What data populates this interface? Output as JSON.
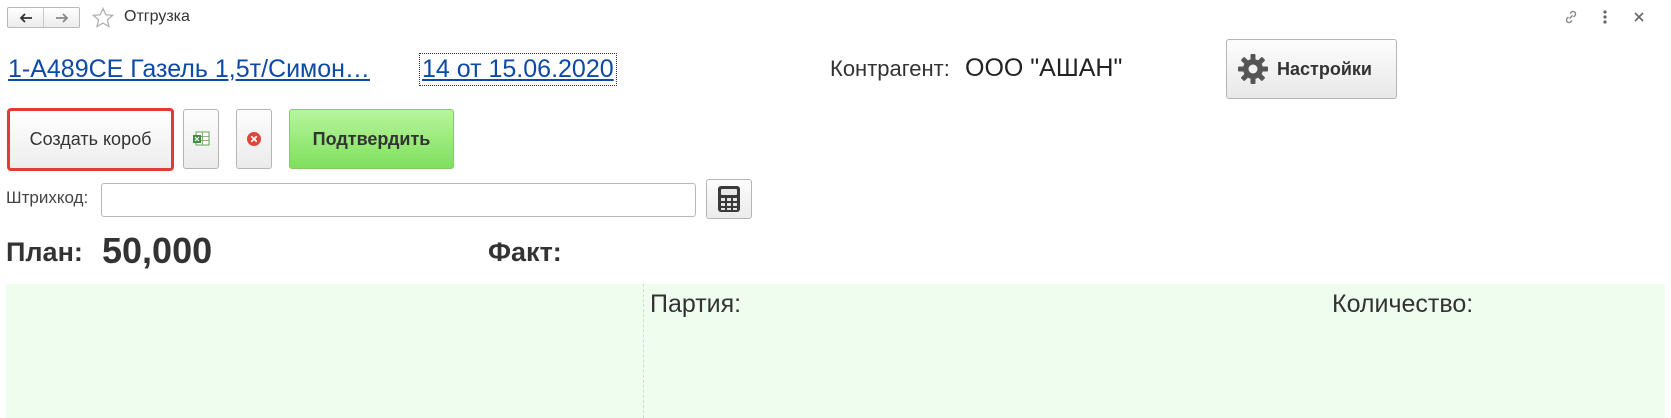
{
  "window": {
    "title": "Отгрузка",
    "icons": [
      "back-arrow-icon",
      "forward-arrow-icon",
      "star-icon",
      "link-icon",
      "more-icon",
      "close-icon"
    ]
  },
  "header": {
    "vehicle_link": "1-А489СЕ Газель 1,5т/Симон…",
    "document_link": "14 от 15.06.2020",
    "contractor_label": "Контрагент:",
    "contractor_value": "ООО \"АШАН\"",
    "settings_label": "Настройки"
  },
  "actions": {
    "create_box_label": "Создать короб",
    "confirm_label": "Подтвердить"
  },
  "barcode": {
    "label": "Штрихкод:",
    "value": "",
    "placeholder": ""
  },
  "totals": {
    "plan_label": "План:",
    "plan_value": "50,000",
    "fact_label": "Факт:"
  },
  "panel": {
    "batch_label": "Партия:",
    "quantity_label": "Количество:"
  },
  "colors": {
    "link": "#0c4aa8",
    "highlight_border": "#e03c31",
    "confirm_button": "#8fe66b",
    "panel_background": "#effdee"
  }
}
